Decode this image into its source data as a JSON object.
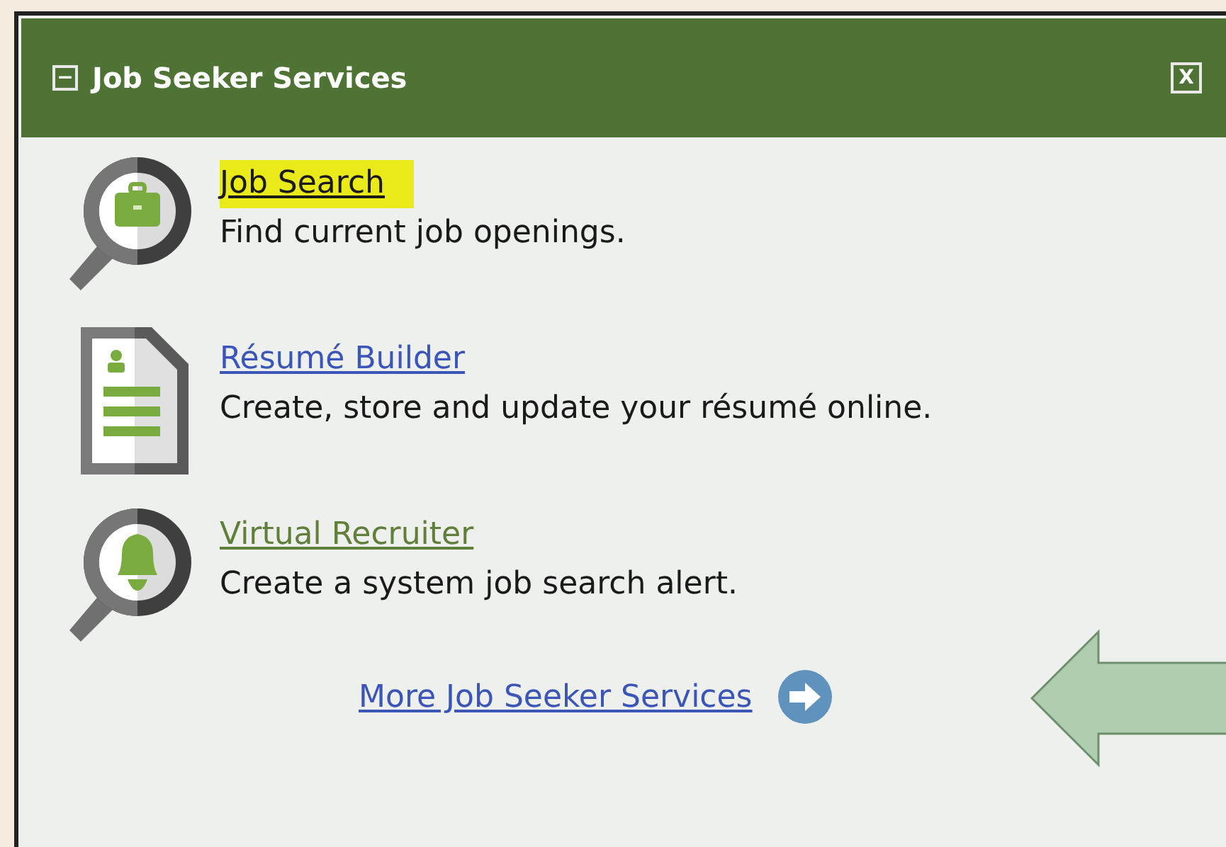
{
  "panel": {
    "title": "Job Seeker Services",
    "collapse_icon": "−",
    "close_label": "X"
  },
  "services": [
    {
      "kind": "search-briefcase",
      "link": "Job Search",
      "highlighted": true,
      "visited": false,
      "description": "Find current job openings."
    },
    {
      "kind": "document",
      "link": "Résumé Builder",
      "highlighted": false,
      "visited": false,
      "description": "Create, store and update your résumé online."
    },
    {
      "kind": "search-bell",
      "link": "Virtual Recruiter",
      "highlighted": false,
      "visited": true,
      "description": "Create a system job search alert."
    }
  ],
  "more_link": "More Job Seeker Services"
}
